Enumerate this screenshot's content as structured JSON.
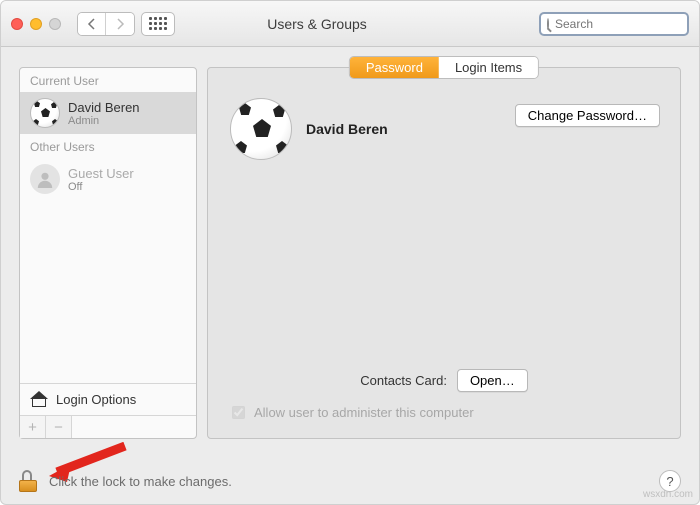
{
  "window": {
    "title": "Users & Groups"
  },
  "search": {
    "placeholder": "Search"
  },
  "sidebar": {
    "current_label": "Current User",
    "other_label": "Other Users",
    "current": {
      "name": "David Beren",
      "role": "Admin"
    },
    "other": {
      "name": "Guest User",
      "status": "Off"
    },
    "login_options": "Login Options"
  },
  "tabs": {
    "password": "Password",
    "login_items": "Login Items"
  },
  "profile": {
    "name": "David Beren"
  },
  "buttons": {
    "change_password": "Change Password…",
    "open": "Open…"
  },
  "contacts_label": "Contacts Card:",
  "admin_checkbox": "Allow user to administer this computer",
  "footer_hint": "Click the lock to make changes.",
  "help": "?",
  "watermark": "wsxdn.com"
}
